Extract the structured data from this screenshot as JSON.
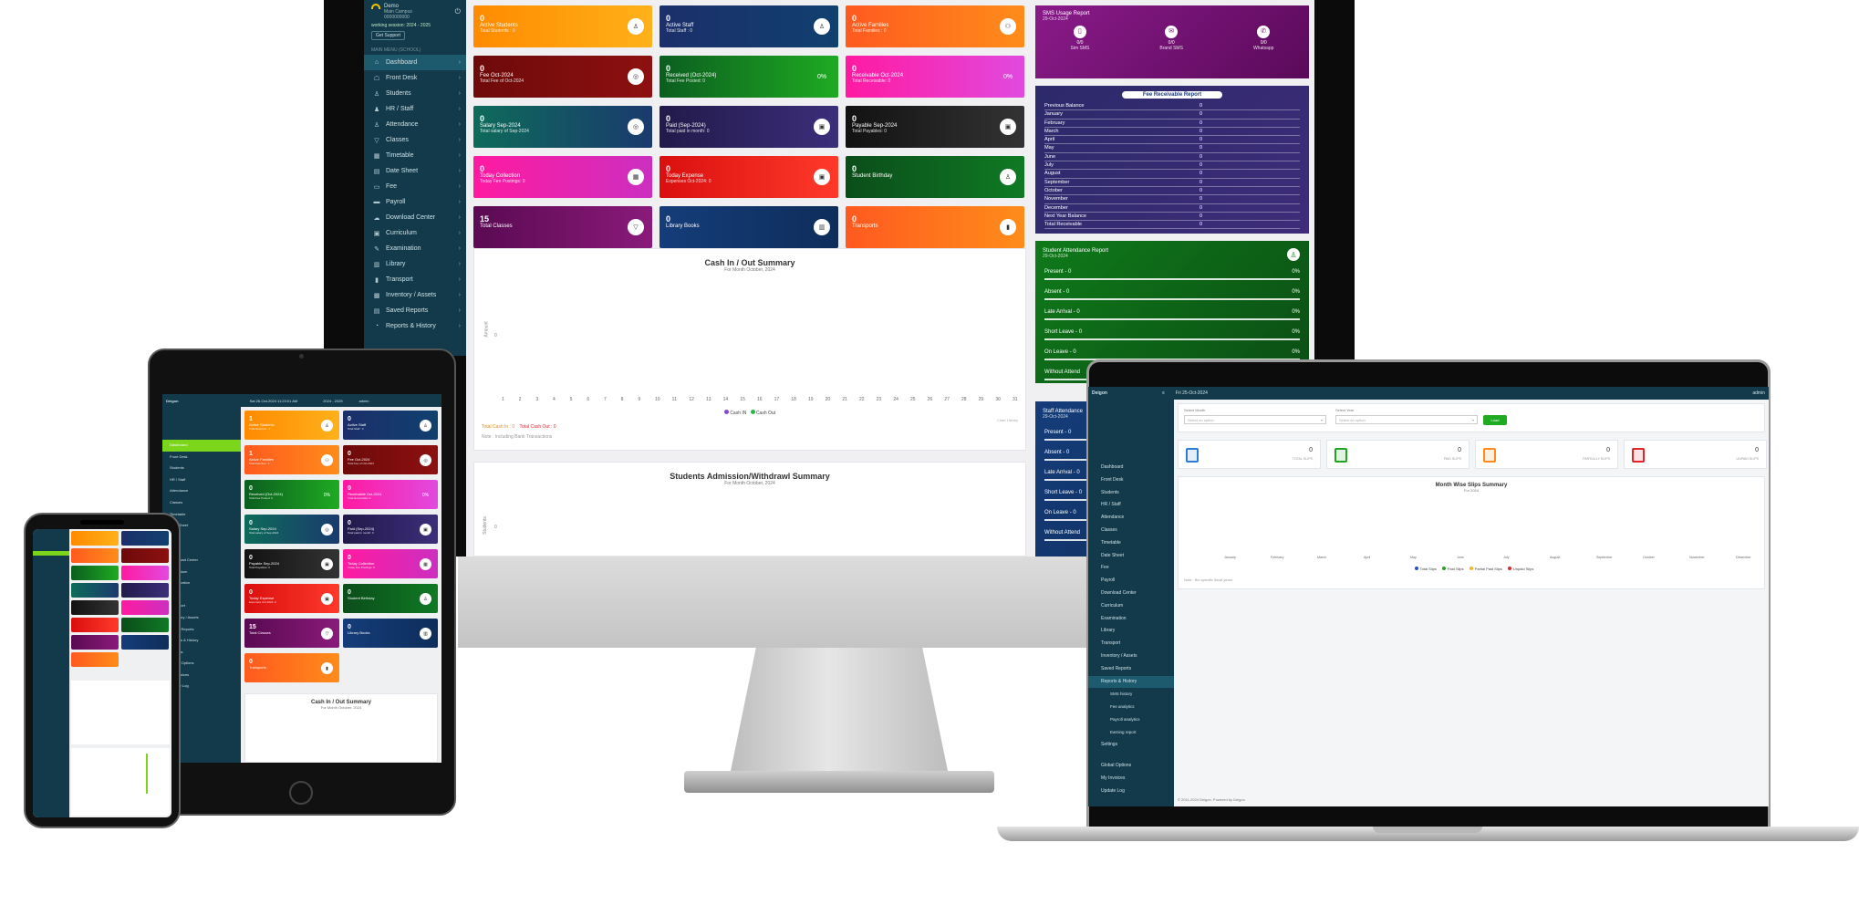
{
  "desktop": {
    "sidebar": {
      "user_name": "Demo",
      "user_sub1": "Main Campus",
      "user_sub2": "0000000000",
      "session": "working session: 2024 - 2025",
      "support": "Get Support",
      "section": "MAIN MENU (SCHOOL)",
      "items": [
        {
          "label": "Dashboard",
          "icon": "home-icon",
          "glyph": "⌂",
          "active": true
        },
        {
          "label": "Front Desk",
          "icon": "desk-icon",
          "glyph": "☖"
        },
        {
          "label": "Students",
          "icon": "student-icon",
          "glyph": "♙"
        },
        {
          "label": "HR / Staff",
          "icon": "staff-icon",
          "glyph": "♟"
        },
        {
          "label": "Attendance",
          "icon": "attendance-icon",
          "glyph": "♙"
        },
        {
          "label": "Classes",
          "icon": "classes-icon",
          "glyph": "▽"
        },
        {
          "label": "Timetable",
          "icon": "timetable-icon",
          "glyph": "▦"
        },
        {
          "label": "Date Sheet",
          "icon": "datesheet-icon",
          "glyph": "▤"
        },
        {
          "label": "Fee",
          "icon": "fee-icon",
          "glyph": "▭"
        },
        {
          "label": "Payroll",
          "icon": "payroll-icon",
          "glyph": "▬"
        },
        {
          "label": "Download Center",
          "icon": "download-icon",
          "glyph": "☁"
        },
        {
          "label": "Curriculum",
          "icon": "curriculum-icon",
          "glyph": "▣"
        },
        {
          "label": "Examination",
          "icon": "exam-icon",
          "glyph": "✎"
        },
        {
          "label": "Library",
          "icon": "library-icon",
          "glyph": "▥"
        },
        {
          "label": "Transport",
          "icon": "bus-icon",
          "glyph": "▮"
        },
        {
          "label": "Inventory / Assets",
          "icon": "inventory-icon",
          "glyph": "▩"
        },
        {
          "label": "Saved Reports",
          "icon": "saved-icon",
          "glyph": "▤"
        },
        {
          "label": "Reports & History",
          "icon": "reports-icon",
          "glyph": "◔"
        }
      ]
    },
    "cards": [
      {
        "value": "0",
        "label": "Active Students",
        "sub": "Total Students : 0",
        "grad": "g-orange",
        "glyph": "♙"
      },
      {
        "value": "0",
        "label": "Active Staff",
        "sub": "Total Staff : 0",
        "grad": "g-navy",
        "glyph": "♙"
      },
      {
        "value": "0",
        "label": "Active Families",
        "sub": "Total Families : 0",
        "grad": "g-orange2",
        "glyph": "⚇"
      },
      {
        "value": "0",
        "label": "Fee Oct-2024",
        "sub": "Total Fee of Oct-2024",
        "grad": "g-maroon",
        "glyph": "◎"
      },
      {
        "value": "0",
        "label": "Received (Oct-2024)",
        "sub": "Total Fee Posted: 0",
        "grad": "g-green",
        "glyph": "0%"
      },
      {
        "value": "0",
        "label": "Receivable Oct-2024",
        "sub": "Total Receivable: 0",
        "grad": "g-pink",
        "glyph": "0%"
      },
      {
        "value": "0",
        "label": "Salary Sep-2024",
        "sub": "Total salary of Sep-2024",
        "grad": "g-teal",
        "glyph": "◎"
      },
      {
        "value": "0",
        "label": "Paid (Sep-2024)",
        "sub": "Total paid in month: 0",
        "grad": "g-indigo",
        "glyph": "▣"
      },
      {
        "value": "0",
        "label": "Payable Sep-2024",
        "sub": "Total Payables: 0",
        "grad": "g-black",
        "glyph": "▣"
      },
      {
        "value": "0",
        "label": "Today Collection",
        "sub": "Today Fee Postings: 0",
        "grad": "g-magenta",
        "glyph": "▦"
      },
      {
        "value": "0",
        "label": "Today Expense",
        "sub": "Expenses Oct-2024: 0",
        "grad": "g-red",
        "glyph": "▣"
      },
      {
        "value": "0",
        "label": "Student Birthday",
        "sub": "",
        "grad": "g-dkgreen",
        "glyph": "♙"
      },
      {
        "value": "15",
        "label": "Total Classes",
        "sub": "",
        "grad": "g-purple",
        "glyph": "▽"
      },
      {
        "value": "0",
        "label": "Library Books",
        "sub": "",
        "grad": "g-blue2",
        "glyph": "▥"
      },
      {
        "value": "0",
        "label": "Transports",
        "sub": "",
        "grad": "g-orange2",
        "glyph": "▮"
      }
    ],
    "cash_chart": {
      "title": "Cash In / Out Summary",
      "subtitle": "For Month October, 2024",
      "ylabel": "Amount",
      "yzero": "0",
      "days": [
        "1",
        "2",
        "3",
        "4",
        "5",
        "6",
        "7",
        "8",
        "9",
        "10",
        "11",
        "12",
        "13",
        "14",
        "15",
        "16",
        "17",
        "18",
        "19",
        "20",
        "21",
        "22",
        "23",
        "24",
        "25",
        "26",
        "27",
        "28",
        "29",
        "30",
        "31"
      ],
      "legend_in": "Cash IN",
      "legend_out": "Cash Out",
      "credit": "Chart Library",
      "total_in": "Total Cash In : 0",
      "total_out": "Total Cash Out : 0",
      "note": "Note : Including Bank Transactions"
    },
    "admission_chart": {
      "title": "Students Admission/Withdrawl Summary",
      "subtitle": "For Month October, 2024",
      "ylabel": "Students",
      "yzero": "0"
    },
    "sms": {
      "title": "SMS Usage Report",
      "date": "29-Oct-2024",
      "items": [
        {
          "value": "0/0",
          "label": "Sim SMS",
          "icon": "sim-icon",
          "glyph": "▯"
        },
        {
          "value": "0/0",
          "label": "Brand SMS",
          "icon": "brand-sms-icon",
          "glyph": "✉"
        },
        {
          "value": "0/0",
          "label": "Whatsapp",
          "icon": "whatsapp-icon",
          "glyph": "✆"
        }
      ]
    },
    "receivable": {
      "title": "Fee Receivable Report",
      "rows": [
        {
          "label": "Previous Balance",
          "value": "0"
        },
        {
          "label": "January",
          "value": "0"
        },
        {
          "label": "February",
          "value": "0"
        },
        {
          "label": "March",
          "value": "0"
        },
        {
          "label": "April",
          "value": "0"
        },
        {
          "label": "May",
          "value": "0"
        },
        {
          "label": "June",
          "value": "0"
        },
        {
          "label": "July",
          "value": "0"
        },
        {
          "label": "August",
          "value": "0"
        },
        {
          "label": "September",
          "value": "0"
        },
        {
          "label": "October",
          "value": "0"
        },
        {
          "label": "November",
          "value": "0"
        },
        {
          "label": "December",
          "value": "0"
        },
        {
          "label": "Next Year Balance",
          "value": "0"
        },
        {
          "label": "Total Receivable",
          "value": "0"
        }
      ]
    },
    "student_att": {
      "title": "Student Attendance Report",
      "date": "29-Oct-2024",
      "rows": [
        {
          "label": "Present - 0",
          "value": "0%"
        },
        {
          "label": "Absent - 0",
          "value": "0%"
        },
        {
          "label": "Late Arrival - 0",
          "value": "0%"
        },
        {
          "label": "Short Leave - 0",
          "value": "0%"
        },
        {
          "label": "On Leave - 0",
          "value": "0%"
        },
        {
          "label": "Without Attend",
          "value": ""
        }
      ]
    },
    "staff_att": {
      "title": "Staff Attendance",
      "date": "29-Oct-2024",
      "rows": [
        {
          "label": "Present - 0"
        },
        {
          "label": "Absent - 0"
        },
        {
          "label": "Late Arrival - 0"
        },
        {
          "label": "Short Leave - 0"
        },
        {
          "label": "On Leave - 0"
        },
        {
          "label": "Without Attend"
        }
      ]
    }
  },
  "tablet": {
    "brand": "Deigon",
    "datetime": "Sat 26-Oct-2024 11:23:01 AM",
    "session": "2024 - 2025",
    "user": "admin",
    "menu": [
      "Dashboard",
      "Front Desk",
      "Students",
      "HR / Staff",
      "Attendance",
      "Classes",
      "Timetable",
      "Date Sheet",
      "Fee",
      "Payroll",
      "Download Center",
      "Curriculum",
      "Examination",
      "Library",
      "Transport",
      "Inventory / Assets",
      "Saved Reports",
      "Reports & History",
      "Settings",
      "Global Options",
      "My Invoices",
      "Update Log"
    ],
    "cards": [
      {
        "value": "1",
        "label": "Active Students",
        "sub": "Total Students : 1",
        "grad": "g-orange",
        "glyph": "♙"
      },
      {
        "value": "0",
        "label": "Active Staff",
        "sub": "Total Staff : 0",
        "grad": "g-navy",
        "glyph": "♙"
      },
      {
        "value": "1",
        "label": "Active Families",
        "sub": "Total Families : 1",
        "grad": "g-orange2",
        "glyph": "⚇"
      },
      {
        "value": "0",
        "label": "Fee Oct-2024",
        "sub": "Total Fee of Oct-2024",
        "grad": "g-maroon",
        "glyph": "◎"
      },
      {
        "value": "0",
        "label": "Received (Oct-2024)",
        "sub": "Total Fee Posted: 0",
        "grad": "g-green",
        "glyph": "0%"
      },
      {
        "value": "0",
        "label": "Receivable Oct-2024",
        "sub": "Total Receivable: 0",
        "grad": "g-pink",
        "glyph": "0%"
      },
      {
        "value": "0",
        "label": "Salary Sep-2024",
        "sub": "Total salary of Sep-2024",
        "grad": "g-teal",
        "glyph": "◎"
      },
      {
        "value": "0",
        "label": "Paid (Sep-2024)",
        "sub": "Total paid in month: 0",
        "grad": "g-indigo",
        "glyph": "▣"
      },
      {
        "value": "0",
        "label": "Payable Sep-2024",
        "sub": "Total Payables: 0",
        "grad": "g-black",
        "glyph": "▣"
      },
      {
        "value": "0",
        "label": "Today Collection",
        "sub": "Today Fee Postings: 0",
        "grad": "g-magenta",
        "glyph": "▦"
      },
      {
        "value": "0",
        "label": "Today Expense",
        "sub": "Expenses Oct-2024: 0",
        "grad": "g-red",
        "glyph": "▣"
      },
      {
        "value": "0",
        "label": "Student Birthday",
        "sub": "",
        "grad": "g-dkgreen",
        "glyph": "♙"
      },
      {
        "value": "15",
        "label": "Total Classes",
        "sub": "",
        "grad": "g-purple",
        "glyph": "▽"
      },
      {
        "value": "0",
        "label": "Library Books",
        "sub": "",
        "grad": "g-blue2",
        "glyph": "▥"
      },
      {
        "value": "0",
        "label": "Transports",
        "sub": "",
        "grad": "g-orange2",
        "glyph": "▮"
      }
    ],
    "chart_title": "Cash In / Out Summary",
    "chart_sub": "For Month October, 2024"
  },
  "laptop": {
    "brand": "Deigon",
    "datetime": "Fri 25-Oct-2024",
    "user": "admin",
    "select_month_label": "Select Month",
    "select_month_placeholder": "Select an option",
    "select_year_label": "Select Year",
    "select_year_placeholder": "Select an option",
    "load_button": "Load",
    "stats": [
      {
        "value": "0",
        "label": "TOTAL SLIPS",
        "color": "#2a7fd4",
        "icon": "slips-icon"
      },
      {
        "value": "0",
        "label": "PAID SLIPS",
        "color": "#22a322",
        "icon": "paid-icon"
      },
      {
        "value": "0",
        "label": "PARTIALLY SLIPS",
        "color": "#ff8a1a",
        "icon": "partial-icon"
      },
      {
        "value": "0",
        "label": "UNPAID SLIPS",
        "color": "#e0242a",
        "icon": "unpaid-icon"
      }
    ],
    "chart_title": "Month Wise Slips Summary",
    "chart_sub": "For 2024",
    "months": [
      "January",
      "February",
      "March",
      "April",
      "May",
      "June",
      "July",
      "August",
      "September",
      "October",
      "November",
      "December"
    ],
    "legend": [
      {
        "label": "Total Slips",
        "color": "#2a4fd4"
      },
      {
        "label": "Paid Slips",
        "color": "#22a322"
      },
      {
        "label": "Partial Paid Slips",
        "color": "#ffb01a"
      },
      {
        "label": "Unpaid Slips",
        "color": "#e0242a"
      }
    ],
    "note": "Note : Bin specific fiscal years",
    "menu": [
      "Dashboard",
      "Front Desk",
      "Students",
      "HR / Staff",
      "Attendance",
      "Classes",
      "Timetable",
      "Date Sheet",
      "Fee",
      "Payroll",
      "Download Center",
      "Curriculum",
      "Examination",
      "Library",
      "Transport",
      "Inventory / Assets",
      "Saved Reports",
      "Reports & History"
    ],
    "submenu": [
      "SMS history",
      "Fee analytics",
      "Payroll analytics",
      "Earning report"
    ],
    "menu2": [
      "Settings",
      "Global Options",
      "My Invoices",
      "Update Log"
    ],
    "footer": "© 2011-2024 Deigon. Powered by Deigon"
  }
}
